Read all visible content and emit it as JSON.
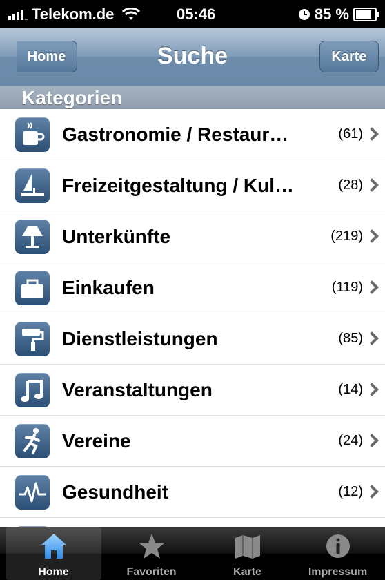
{
  "status": {
    "carrier": "Telekom.de",
    "time": "05:46",
    "battery": "85 %",
    "battery_level": 0.85
  },
  "nav": {
    "back_label": "Home",
    "title": "Suche",
    "right_label": "Karte"
  },
  "section": {
    "title": "Kategorien"
  },
  "rows": [
    {
      "name": "Gastronomie / Restaur…",
      "count": "(61)",
      "icon": "cup-icon"
    },
    {
      "name": "Freizeitgestaltung / Kul…",
      "count": "(28)",
      "icon": "sailboat-icon"
    },
    {
      "name": "Unterkünfte",
      "count": "(219)",
      "icon": "lamp-icon"
    },
    {
      "name": "Einkaufen",
      "count": "(119)",
      "icon": "shopping-bag-icon"
    },
    {
      "name": "Dienstleistungen",
      "count": "(85)",
      "icon": "paint-roller-icon"
    },
    {
      "name": "Veranstaltungen",
      "count": "(14)",
      "icon": "music-note-icon"
    },
    {
      "name": "Vereine",
      "count": "(24)",
      "icon": "runner-icon"
    },
    {
      "name": "Gesundheit",
      "count": "(12)",
      "icon": "heartbeat-icon"
    }
  ],
  "tabs": [
    {
      "label": "Home",
      "icon": "home-icon",
      "active": true
    },
    {
      "label": "Favoriten",
      "icon": "star-icon",
      "active": false
    },
    {
      "label": "Karte",
      "icon": "map-icon",
      "active": false
    },
    {
      "label": "Impressum",
      "icon": "info-icon",
      "active": false
    }
  ]
}
